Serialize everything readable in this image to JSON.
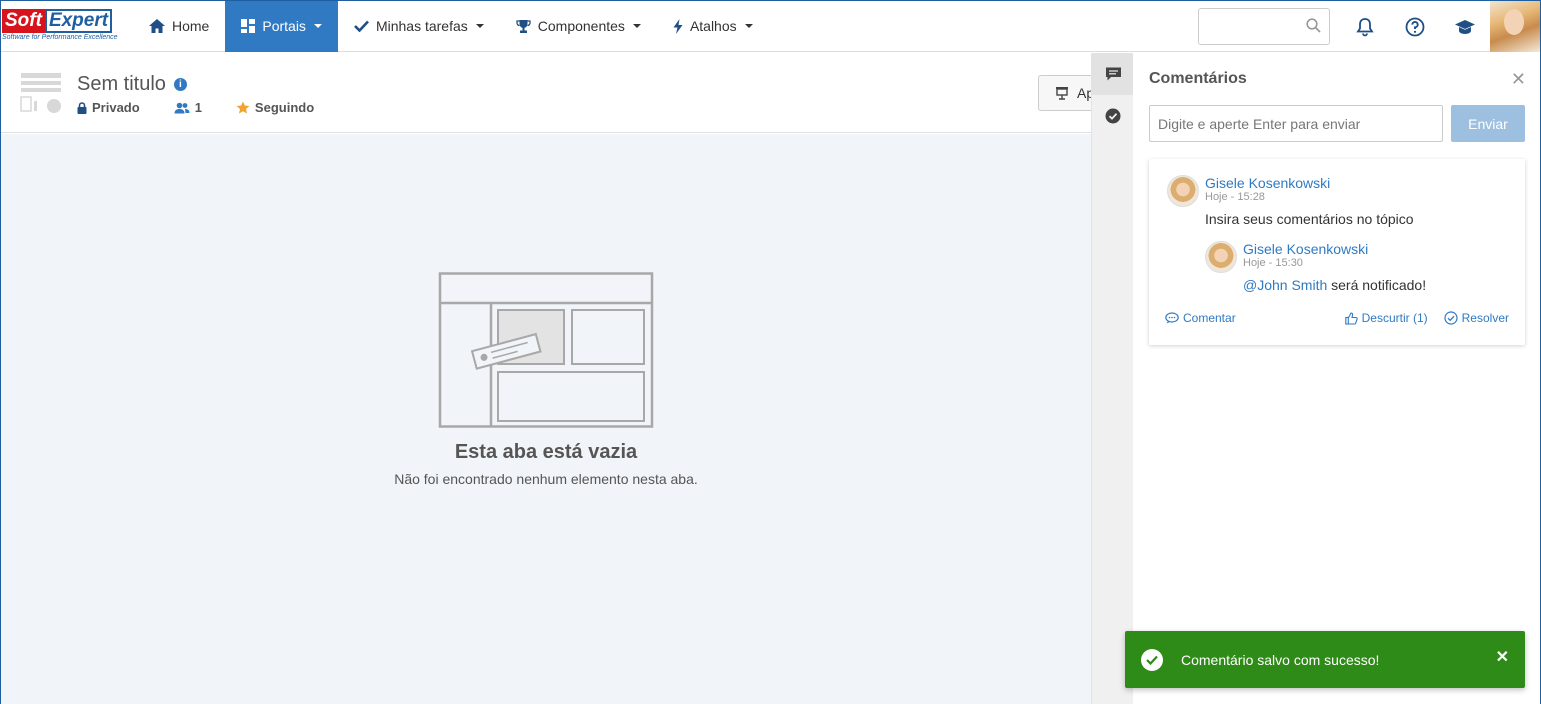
{
  "brand": {
    "name_part1": "Soft",
    "name_part2": "Expert",
    "tagline": "Software for Performance Excellence"
  },
  "nav": {
    "items": [
      {
        "label": "Home",
        "icon": "home-icon",
        "active": false,
        "dropdown": false
      },
      {
        "label": "Portais",
        "icon": "dashboard-icon",
        "active": true,
        "dropdown": true
      },
      {
        "label": "Minhas tarefas",
        "icon": "check-icon",
        "active": false,
        "dropdown": true
      },
      {
        "label": "Componentes",
        "icon": "trophy-icon",
        "active": false,
        "dropdown": true
      },
      {
        "label": "Atalhos",
        "icon": "bolt-icon",
        "active": false,
        "dropdown": true
      }
    ],
    "search_placeholder": "",
    "right_icons": [
      "bell-icon",
      "help-icon",
      "graduation-cap-icon"
    ]
  },
  "page": {
    "title": "Sem titulo",
    "privacy": "Privado",
    "members": "1",
    "following": "Seguindo",
    "apply_label": "Ap"
  },
  "empty_state": {
    "title": "Esta aba está vazia",
    "subtitle": "Não foi encontrado nenhum elemento nesta aba."
  },
  "comments": {
    "title": "Comentários",
    "input_placeholder": "Digite e aperte Enter para enviar",
    "send_label": "Enviar",
    "thread": {
      "author": "Gisele Kosenkowski",
      "time": "Hoje - 15:28",
      "text": "Insira seus comentários no tópico",
      "reply": {
        "author": "Gisele Kosenkowski",
        "time": "Hoje - 15:30",
        "mention": "@John Smith",
        "text": " será notificado!"
      }
    },
    "actions": {
      "comment": "Comentar",
      "unlike": "Descurtir (1)",
      "resolve": "Resolver"
    }
  },
  "toast": {
    "message": "Comentário salvo com sucesso!",
    "color": "#2e8b17"
  },
  "colors": {
    "primary": "#2f7ac3",
    "brand_red": "#d7141c",
    "brand_blue": "#1f5fa0"
  }
}
